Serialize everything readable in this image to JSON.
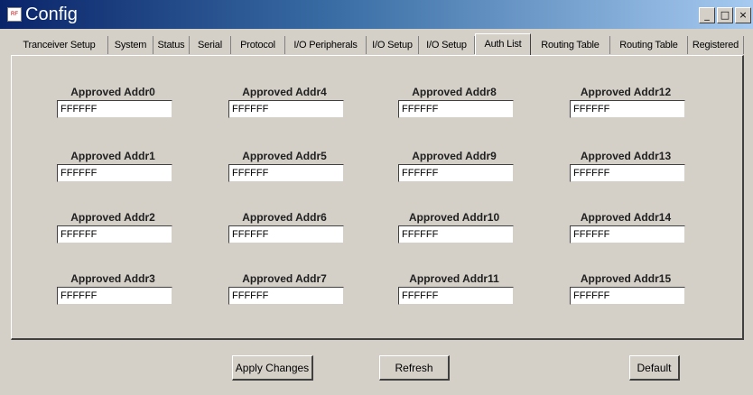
{
  "window": {
    "title": "Config",
    "icon_text": "RF",
    "minimize_glyph": "_",
    "maximize_glyph": "□",
    "close_glyph": "×"
  },
  "tabs": [
    {
      "label": "Tranceiver Setup",
      "active": false
    },
    {
      "label": "System",
      "active": false
    },
    {
      "label": "Status",
      "active": false
    },
    {
      "label": "Serial",
      "active": false
    },
    {
      "label": "Protocol",
      "active": false
    },
    {
      "label": "I/O Peripherals",
      "active": false
    },
    {
      "label": "I/O Setup",
      "active": false
    },
    {
      "label": "I/O Setup",
      "active": false
    },
    {
      "label": "Auth List",
      "active": true
    },
    {
      "label": "Routing Table",
      "active": false
    },
    {
      "label": "Routing Table",
      "active": false
    },
    {
      "label": "Registered",
      "active": false
    }
  ],
  "fields": [
    {
      "label": "Approved Addr0",
      "value": "FFFFFF"
    },
    {
      "label": "Approved Addr1",
      "value": "FFFFFF"
    },
    {
      "label": "Approved Addr2",
      "value": "FFFFFF"
    },
    {
      "label": "Approved Addr3",
      "value": "FFFFFF"
    },
    {
      "label": "Approved Addr4",
      "value": "FFFFFF"
    },
    {
      "label": "Approved Addr5",
      "value": "FFFFFF"
    },
    {
      "label": "Approved Addr6",
      "value": "FFFFFF"
    },
    {
      "label": "Approved Addr7",
      "value": "FFFFFF"
    },
    {
      "label": "Approved Addr8",
      "value": "FFFFFF"
    },
    {
      "label": "Approved Addr9",
      "value": "FFFFFF"
    },
    {
      "label": "Approved Addr10",
      "value": "FFFFFF"
    },
    {
      "label": "Approved Addr11",
      "value": "FFFFFF"
    },
    {
      "label": "Approved Addr12",
      "value": "FFFFFF"
    },
    {
      "label": "Approved Addr13",
      "value": "FFFFFF"
    },
    {
      "label": "Approved Addr14",
      "value": "FFFFFF"
    },
    {
      "label": "Approved Addr15",
      "value": "FFFFFF"
    }
  ],
  "buttons": {
    "apply": "Apply Changes",
    "refresh": "Refresh",
    "default": "Default"
  }
}
